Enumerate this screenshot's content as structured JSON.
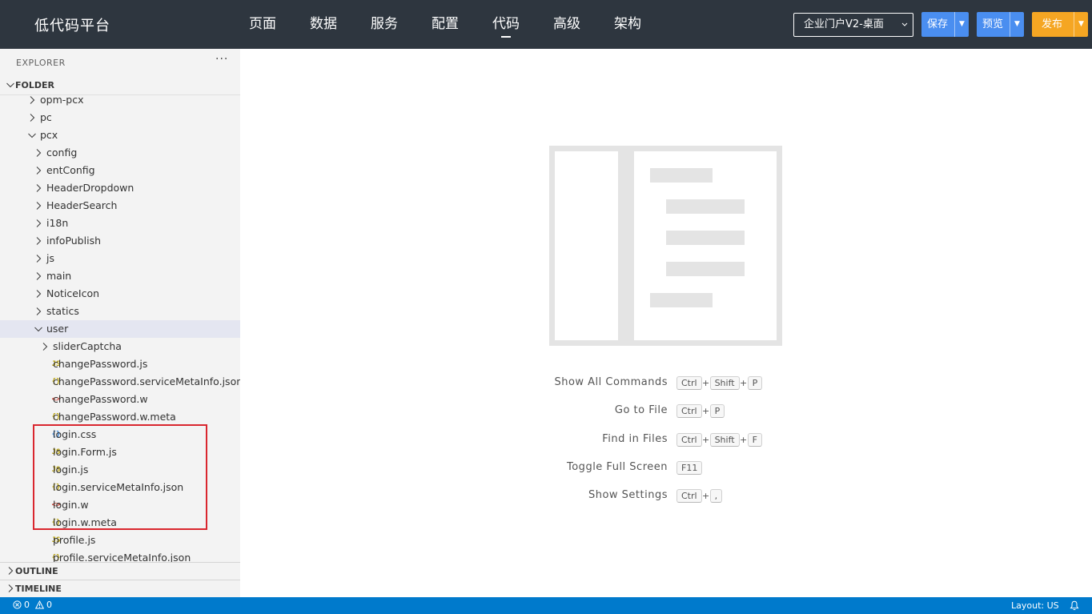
{
  "header": {
    "brand": "低代码平台",
    "nav": [
      "页面",
      "数据",
      "服务",
      "配置",
      "代码",
      "高级",
      "架构"
    ],
    "active_nav": "代码",
    "app_select": "企业门户V2-桌面",
    "save_label": "保存",
    "preview_label": "预览",
    "publish_label": "发布"
  },
  "sidebar": {
    "explorer_title": "EXPLORER",
    "more": "···",
    "folder_title": "FOLDER",
    "outline_title": "OUTLINE",
    "timeline_title": "TIMELINE",
    "tree": [
      {
        "name": "opm-pcx",
        "kind": "folder",
        "expanded": false,
        "depth": 1
      },
      {
        "name": "pc",
        "kind": "folder",
        "expanded": false,
        "depth": 1
      },
      {
        "name": "pcx",
        "kind": "folder",
        "expanded": true,
        "depth": 1
      },
      {
        "name": "config",
        "kind": "folder",
        "expanded": false,
        "depth": 2
      },
      {
        "name": "entConfig",
        "kind": "folder",
        "expanded": false,
        "depth": 2
      },
      {
        "name": "HeaderDropdown",
        "kind": "folder",
        "expanded": false,
        "depth": 2
      },
      {
        "name": "HeaderSearch",
        "kind": "folder",
        "expanded": false,
        "depth": 2
      },
      {
        "name": "i18n",
        "kind": "folder",
        "expanded": false,
        "depth": 2
      },
      {
        "name": "infoPublish",
        "kind": "folder",
        "expanded": false,
        "depth": 2
      },
      {
        "name": "js",
        "kind": "folder",
        "expanded": false,
        "depth": 2
      },
      {
        "name": "main",
        "kind": "folder",
        "expanded": false,
        "depth": 2
      },
      {
        "name": "NoticeIcon",
        "kind": "folder",
        "expanded": false,
        "depth": 2
      },
      {
        "name": "statics",
        "kind": "folder",
        "expanded": false,
        "depth": 2
      },
      {
        "name": "user",
        "kind": "folder",
        "expanded": true,
        "depth": 2,
        "selected": true
      },
      {
        "name": "sliderCaptcha",
        "kind": "folder",
        "expanded": false,
        "depth": 3
      },
      {
        "name": "changePassword.js",
        "kind": "js",
        "depth": 3
      },
      {
        "name": "changePassword.serviceMetaInfo.json",
        "kind": "json",
        "depth": 3
      },
      {
        "name": "changePassword.w",
        "kind": "w",
        "depth": 3
      },
      {
        "name": "changePassword.w.meta",
        "kind": "json",
        "depth": 3
      },
      {
        "name": "login.css",
        "kind": "css",
        "depth": 3
      },
      {
        "name": "login.Form.js",
        "kind": "js",
        "depth": 3
      },
      {
        "name": "login.js",
        "kind": "js",
        "depth": 3
      },
      {
        "name": "login.serviceMetaInfo.json",
        "kind": "json",
        "depth": 3
      },
      {
        "name": "login.w",
        "kind": "w",
        "depth": 3
      },
      {
        "name": "login.w.meta",
        "kind": "json",
        "depth": 3
      },
      {
        "name": "profile.js",
        "kind": "js",
        "depth": 3
      },
      {
        "name": "profile.serviceMetaInfo.json",
        "kind": "json",
        "depth": 3
      }
    ],
    "icon_text": {
      "js": "JS",
      "json": "{}",
      "css": "{}",
      "w": "<>"
    }
  },
  "shortcuts": [
    {
      "label": "Show All Commands",
      "keys": [
        "Ctrl",
        "Shift",
        "P"
      ]
    },
    {
      "label": "Go to File",
      "keys": [
        "Ctrl",
        "P"
      ]
    },
    {
      "label": "Find in Files",
      "keys": [
        "Ctrl",
        "Shift",
        "F"
      ]
    },
    {
      "label": "Toggle Full Screen",
      "keys": [
        "F11"
      ]
    },
    {
      "label": "Show Settings",
      "keys": [
        "Ctrl",
        ","
      ]
    }
  ],
  "status": {
    "errors": "0",
    "warnings": "0",
    "layout": "Layout: US"
  },
  "colors": {
    "topbar": "#2e363f",
    "primary_button": "#4a8ef0",
    "publish_button": "#f5a623",
    "status_bar": "#007acc",
    "highlight": "#d9262e"
  }
}
